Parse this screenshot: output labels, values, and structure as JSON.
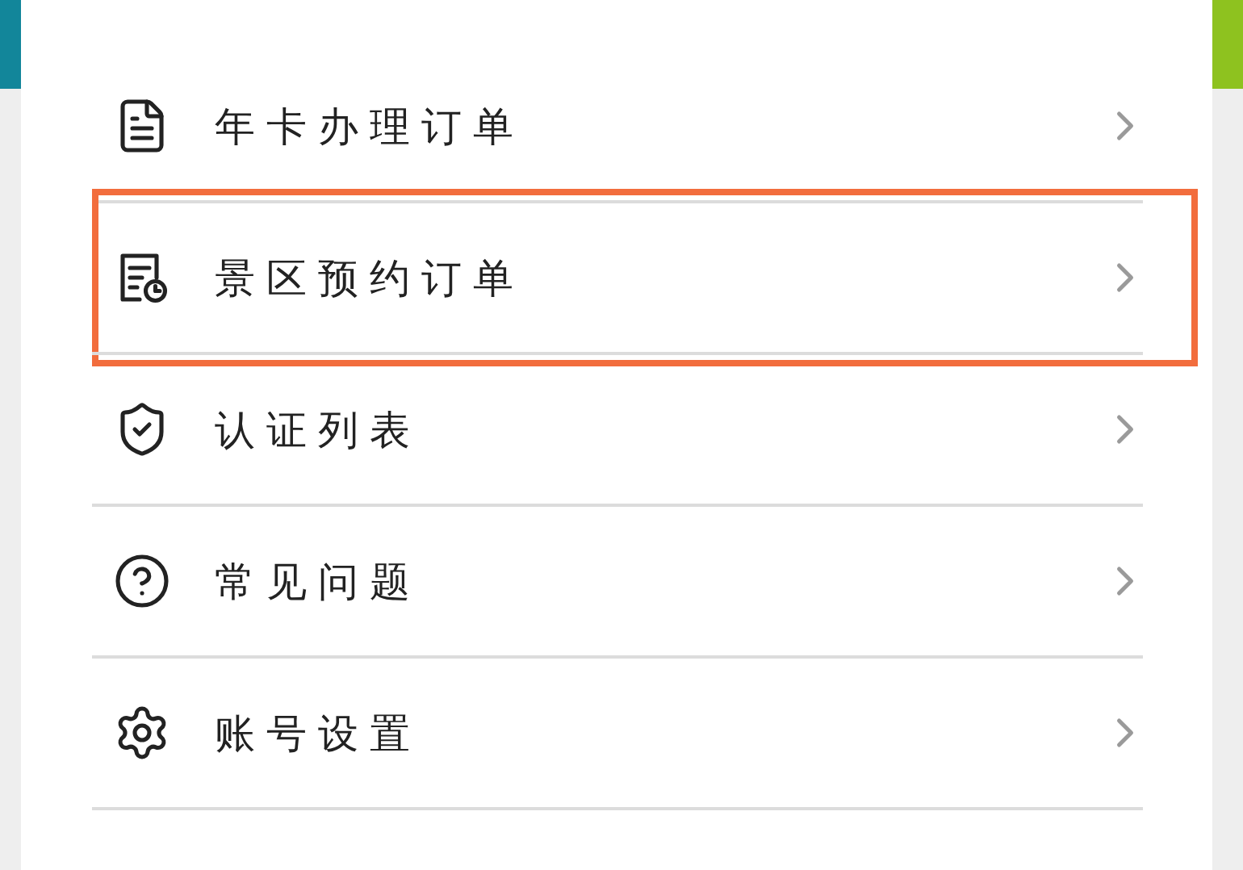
{
  "menu": {
    "items": [
      {
        "label": "年卡办理订单",
        "highlighted": false
      },
      {
        "label": "景区预约订单",
        "highlighted": true
      },
      {
        "label": "认证列表",
        "highlighted": false
      },
      {
        "label": "常见问题",
        "highlighted": false
      },
      {
        "label": "账号设置",
        "highlighted": false
      }
    ]
  }
}
